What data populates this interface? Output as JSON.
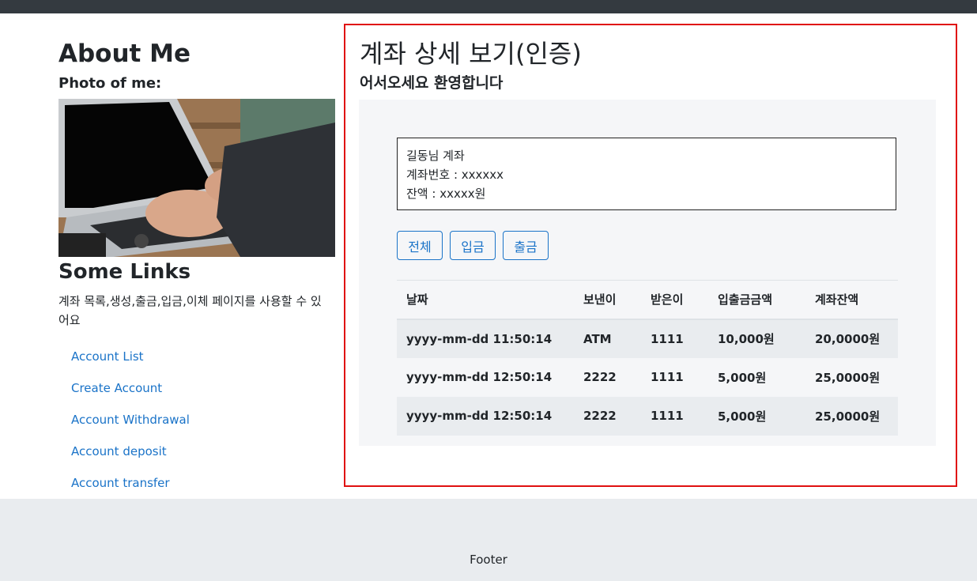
{
  "sidebar": {
    "about_title": "About Me",
    "photo_label": "Photo of me:",
    "links_title": "Some Links",
    "links_desc": "계좌 목록,생성,출금,입금,이체 페이지를 사용할 수 있어요",
    "links": [
      "Account List",
      "Create Account",
      "Account Withdrawal",
      "Account deposit",
      "Account transfer"
    ]
  },
  "main": {
    "title": "계좌 상세 보기(인증)",
    "subtitle": "어서오세요 환영합니다",
    "account": {
      "owner": "길동님 계좌",
      "number": "계좌번호 : xxxxxx",
      "balance": "잔액 : xxxxx원"
    },
    "filters": [
      "전체",
      "입금",
      "출금"
    ],
    "table": {
      "headers": [
        "날짜",
        "보낸이",
        "받은이",
        "입출금금액",
        "계좌잔액"
      ],
      "rows": [
        [
          "yyyy-mm-dd 11:50:14",
          "ATM",
          "1111",
          "10,000원",
          "20,0000원"
        ],
        [
          "yyyy-mm-dd 12:50:14",
          "2222",
          "1111",
          "5,000원",
          "25,0000원"
        ],
        [
          "yyyy-mm-dd 12:50:14",
          "2222",
          "1111",
          "5,000원",
          "25,0000원"
        ]
      ]
    }
  },
  "footer": {
    "text": "Footer"
  },
  "colors": {
    "topbar": "#343a40",
    "link": "#1a73c8",
    "highlight_border": "#e01010",
    "footer_bg": "#e9ecef"
  }
}
